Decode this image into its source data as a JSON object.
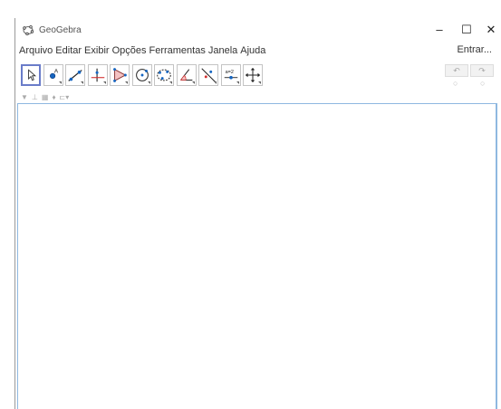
{
  "window": {
    "title": "GeoGebra",
    "min_glyph": "–",
    "max_glyph": "☐",
    "close_glyph": "✕"
  },
  "menubar": {
    "items": [
      "Arquivo",
      "Editar",
      "Exibir",
      "Opções",
      "Ferramentas",
      "Janela",
      "Ajuda"
    ],
    "signin": "Entrar..."
  },
  "toolbar": {
    "tools": [
      {
        "name": "move-tool",
        "icon": "cursor-arrow-icon",
        "selected": true
      },
      {
        "name": "point-tool",
        "icon": "point-icon"
      },
      {
        "name": "line-tool",
        "icon": "line-icon"
      },
      {
        "name": "perpendicular-tool",
        "icon": "perpendicular-line-icon"
      },
      {
        "name": "polygon-tool",
        "icon": "polygon-icon"
      },
      {
        "name": "circle-tool",
        "icon": "circle-icon"
      },
      {
        "name": "conic-tool",
        "icon": "ellipse-icon"
      },
      {
        "name": "angle-tool",
        "icon": "angle-icon"
      },
      {
        "name": "reflect-tool",
        "icon": "reflect-icon"
      },
      {
        "name": "slider-tool",
        "icon": "slider-icon"
      },
      {
        "name": "move-graphics-tool",
        "icon": "move-graphics-icon"
      }
    ],
    "slider_label": "a=2",
    "undo_glyph": "↶",
    "redo_glyph": "↷",
    "undo_sub": "○",
    "redo_sub": "○"
  },
  "stylebar": {
    "toggle_glyph": "▼",
    "axes_glyph": "⊥",
    "grid_glyph": "▦",
    "point_capture_glyph": "♦",
    "label_style_glyph": "⊏▾"
  },
  "colors": {
    "selected_tool_border": "#6a7cc9",
    "graphics_border": "#8fb8e0",
    "point_blue": "#1565c0",
    "accent_red": "#d32f2f"
  }
}
